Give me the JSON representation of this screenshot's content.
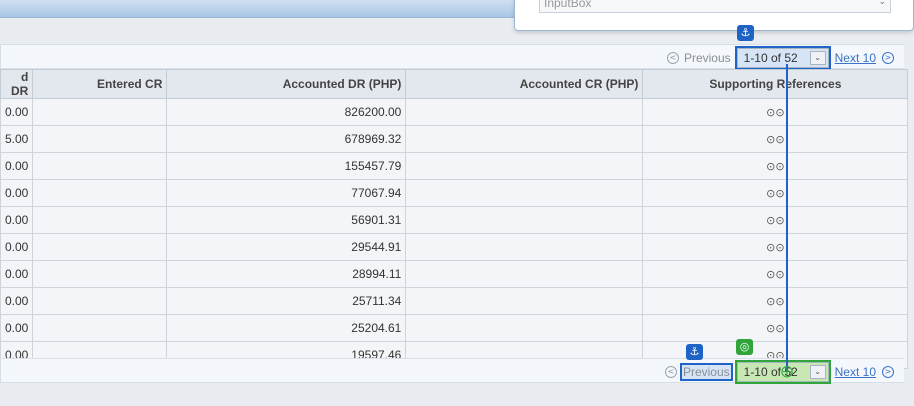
{
  "popup": {
    "input_label": "InputBox"
  },
  "pagination": {
    "previous": "Previous",
    "range": "1-10 of 52",
    "next": "Next 10"
  },
  "table": {
    "columns": [
      "d DR",
      "Entered CR",
      "Accounted DR (PHP)",
      "Accounted CR (PHP)",
      "Supporting References"
    ],
    "rows": [
      {
        "dr": "0.00",
        "accounted_dr": "826200.00"
      },
      {
        "dr": "5.00",
        "accounted_dr": "678969.32"
      },
      {
        "dr": "0.00",
        "accounted_dr": "155457.79"
      },
      {
        "dr": "0.00",
        "accounted_dr": "77067.94"
      },
      {
        "dr": "0.00",
        "accounted_dr": "56901.31"
      },
      {
        "dr": "0.00",
        "accounted_dr": "29544.91"
      },
      {
        "dr": "0.00",
        "accounted_dr": "28994.11"
      },
      {
        "dr": "0.00",
        "accounted_dr": "25711.34"
      },
      {
        "dr": "0.00",
        "accounted_dr": "25204.61"
      },
      {
        "dr": "0.00",
        "accounted_dr": "19597.46"
      }
    ]
  },
  "icons": {
    "glasses": "glasses-icon",
    "anchor": "anchor-icon",
    "target": "target-icon"
  },
  "colors": {
    "highlight_blue": "#1f63c6",
    "highlight_green": "#2fa53a",
    "link": "#3a73c5"
  }
}
